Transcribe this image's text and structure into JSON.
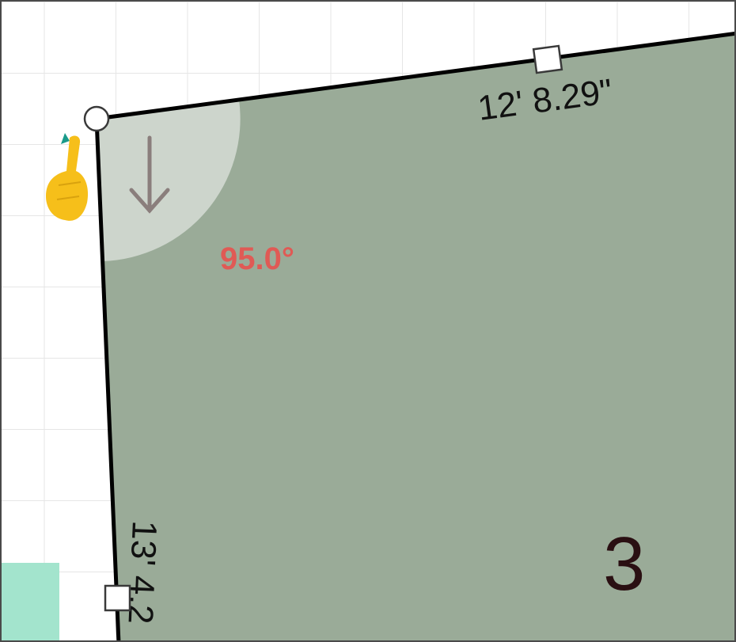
{
  "editor": {
    "room_number": "3",
    "corner_angle": "95.0°",
    "top_wall_length": "12' 8.29\"",
    "left_wall_length": "13' 4.2"
  },
  "colors": {
    "room_fill": "#9aab98",
    "room_wall": "#000000",
    "angle_sector": "#d9e0d8",
    "angle_text": "#e05a55",
    "room_number_text": "#2a0f12",
    "adjacent_room_fill": "#a3e4cd",
    "pointer_hand": "#f6bf1a",
    "grid_line": "#e6e6e6"
  },
  "icons": {
    "drag_pointer": "pointing-hand-icon",
    "direction_arrow": "arrow-down-icon"
  }
}
